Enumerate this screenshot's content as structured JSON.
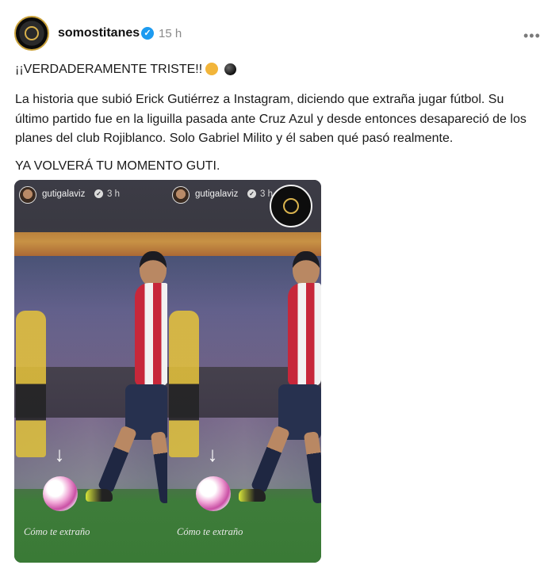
{
  "post": {
    "username": "somostitanes",
    "time": "15 h",
    "headline": "¡¡VERDADERAMENTE TRISTE!!",
    "body": "La historia que subió Erick Gutiérrez a Instagram, diciendo que extraña jugar fútbol. Su último partido fue en la liguilla pasada ante Cruz Azul y desde entonces desapareció de los planes del club Rojiblanco. Solo Gabriel Milito y él saben qué pasó realmente.",
    "closing": "YA VOLVERÁ TU MOMENTO GUTI."
  },
  "icons": {
    "verified": "verified-badge-icon",
    "more": "more-options-icon",
    "emoji1": "sad-face-emoji",
    "emoji2": "black-circle-emoji"
  },
  "story": {
    "username": "gutigalaviz",
    "time": "3 h",
    "caption": "Cómo te extraño"
  },
  "colors": {
    "verified": "#1d9bf0",
    "text": "#1a1a1a",
    "muted": "#8a8a8a"
  }
}
